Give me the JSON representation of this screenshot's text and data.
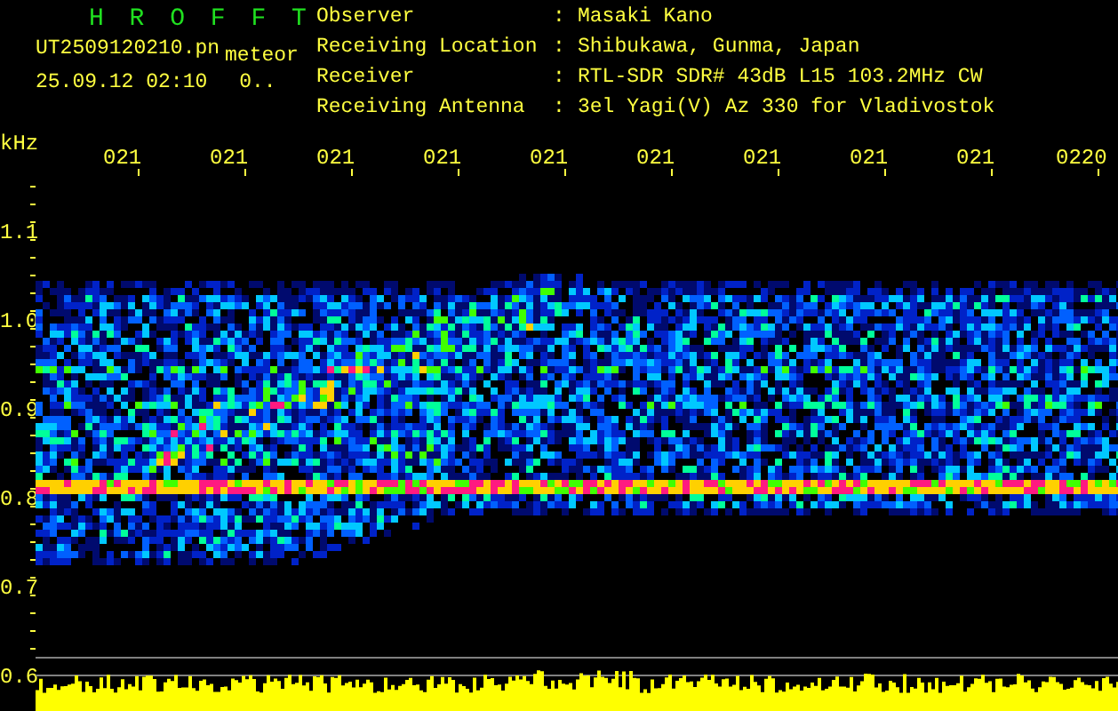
{
  "title": "H R O F F T",
  "file_name": "UT2509120210.pn",
  "file_note": "meteor",
  "date_time": "25.09.12 02:10",
  "count": "0..",
  "info": [
    {
      "label": "Observer",
      "separator": ":",
      "value": "Masaki Kano"
    },
    {
      "label": "Receiving Location",
      "separator": ":",
      "value": "Shibukawa, Gunma, Japan"
    },
    {
      "label": "Receiver",
      "separator": ":",
      "value": "RTL-SDR SDR# 43dB L15 103.2MHz CW"
    },
    {
      "label": "Receiving Antenna",
      "separator": ":",
      "value": "3el Yagi(V) Az 330 for Vladivostok"
    }
  ],
  "plot": {
    "y_unit": "kHz",
    "x_labels": [
      "021",
      "021",
      "021",
      "021",
      "021",
      "021",
      "021",
      "021",
      "021",
      "0220"
    ],
    "y_labels": [
      "1.1",
      "1.0",
      "0.9",
      "0.8",
      "0.7",
      "0.6"
    ]
  }
}
